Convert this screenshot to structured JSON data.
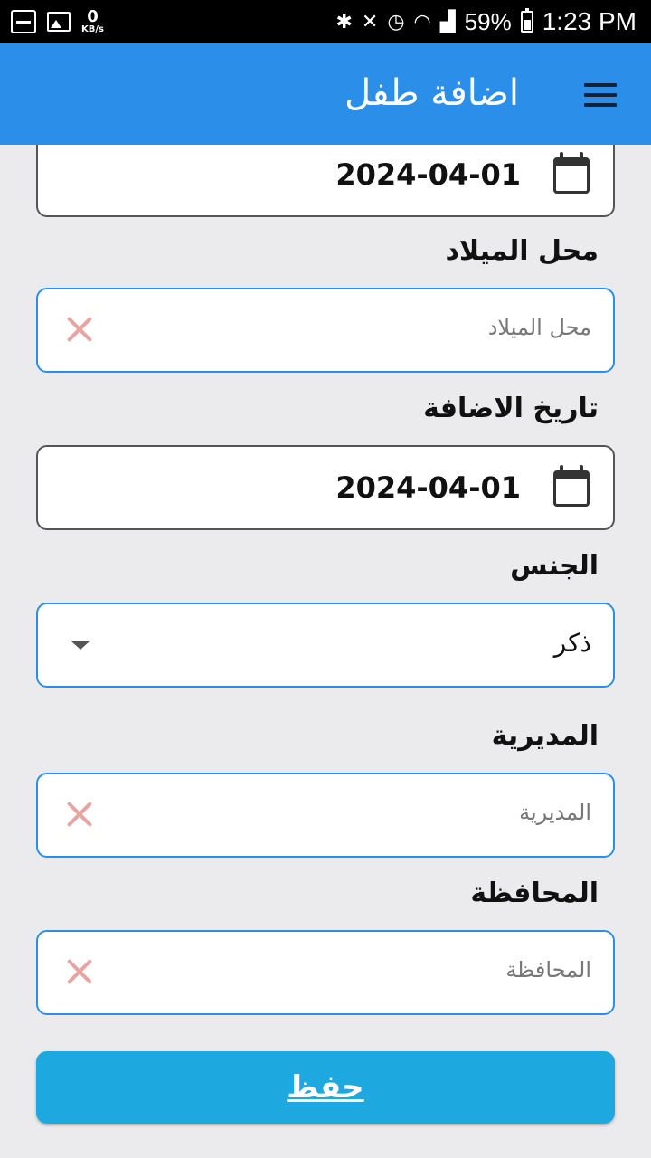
{
  "status_bar": {
    "data_speed_value": "0",
    "data_speed_unit": "KB/s",
    "battery_percent": "59%",
    "time": "1:23 PM",
    "icons": [
      "screenshot-icon",
      "image-icon",
      "bluetooth-icon",
      "mute-icon",
      "alarm-icon",
      "wifi-icon",
      "signal-icon",
      "battery-icon"
    ]
  },
  "app_bar": {
    "title": "اضافة طفل",
    "menu_icon": "hamburger-menu-icon",
    "color": "#2b8fe9"
  },
  "form": {
    "birth_date": {
      "value": "2024-04-01"
    },
    "birth_place": {
      "label": "محل الميلاد",
      "placeholder": "محل الميلاد"
    },
    "add_date": {
      "label": "تاريخ الاضافة",
      "value": "2024-04-01"
    },
    "gender": {
      "label": "الجنس",
      "selected": "ذكر"
    },
    "directorate": {
      "label": "المديرية",
      "placeholder": "المديرية"
    },
    "governorate": {
      "label": "المحافظة",
      "placeholder": "المحافظة"
    },
    "save_label": "حفظ",
    "save_color": "#1ea8e0",
    "clear_icon_color": "#e8a4a0"
  }
}
